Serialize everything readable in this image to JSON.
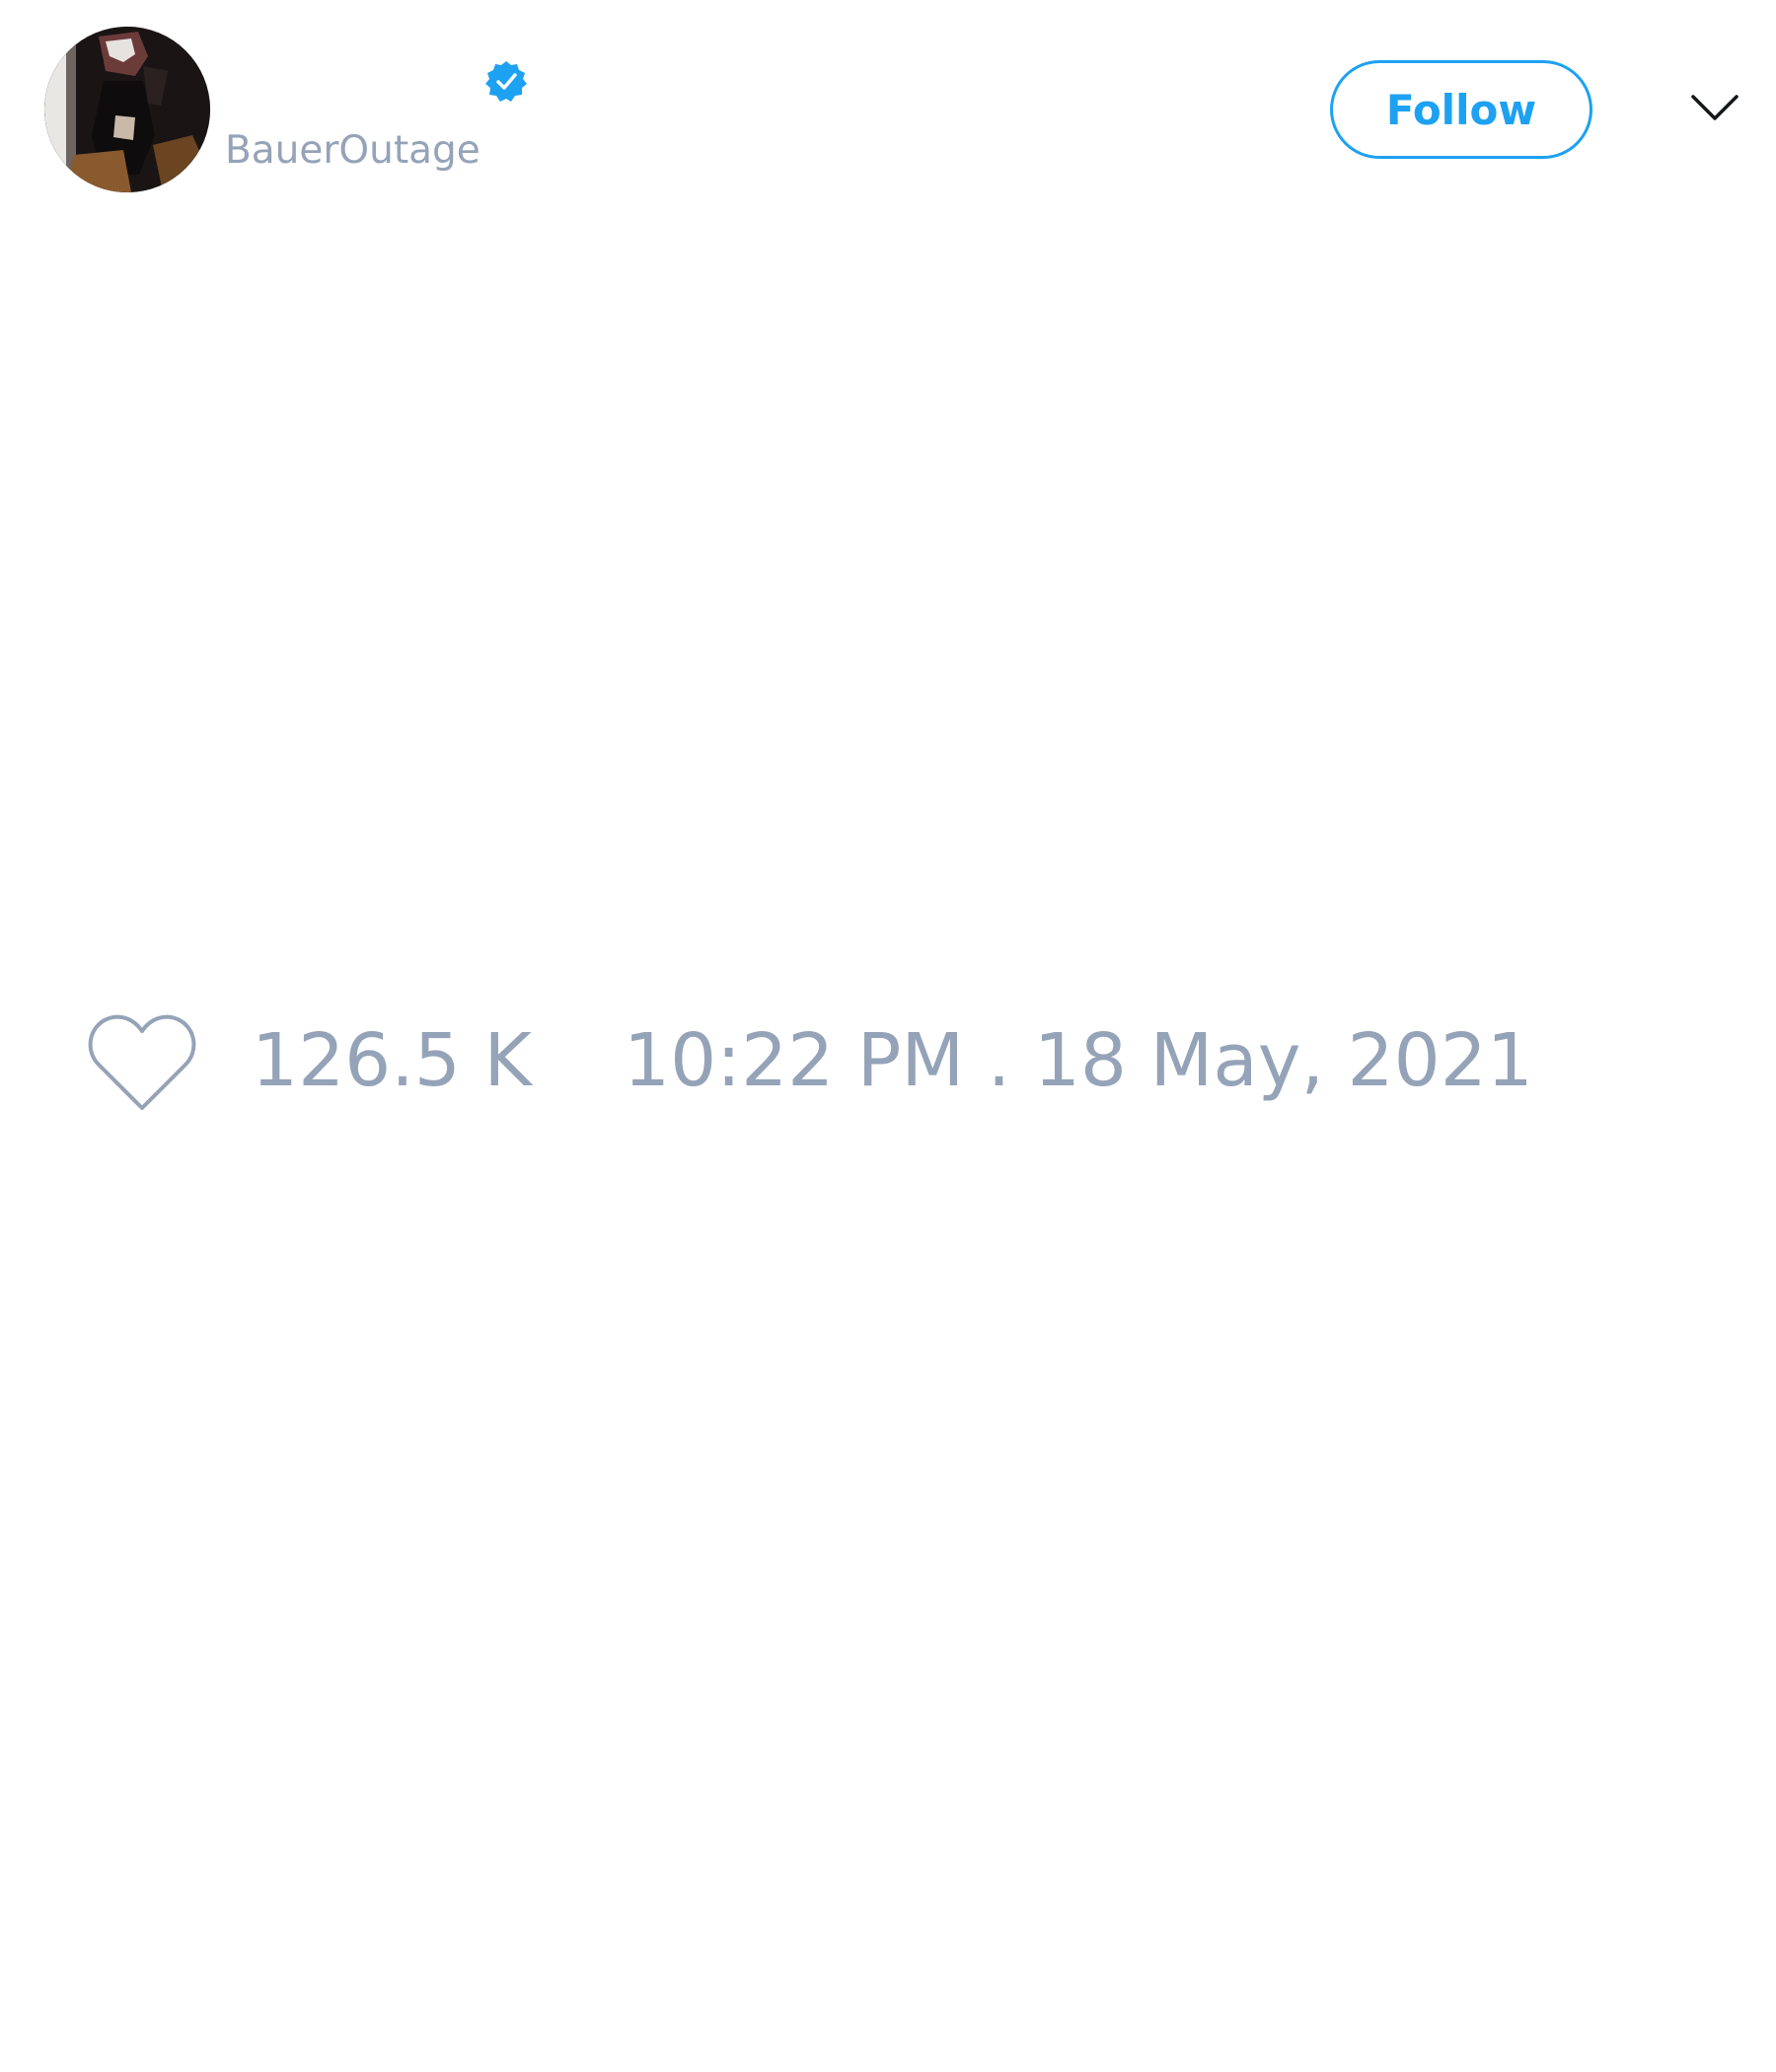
{
  "tweet": {
    "author": {
      "display_name": "",
      "handle": "BauerOutage",
      "verified": true,
      "avatar_icon": "profile-photo"
    },
    "follow_label": "Follow",
    "menu_icon": "chevron-down-icon",
    "like_icon": "heart-outline-icon",
    "like_count": "126.5 K",
    "timestamp": "10:22 PM . 18 May, 2021"
  },
  "colors": {
    "accent": "#1da1f2",
    "muted_text": "#95a3b8",
    "background": "#ffffff"
  }
}
